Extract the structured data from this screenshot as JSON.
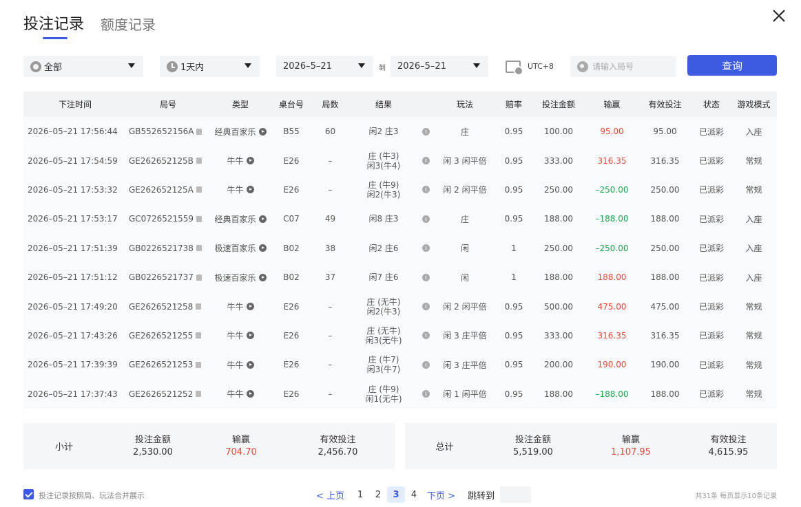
{
  "tabs": [
    {
      "label": "投注记录",
      "active": true
    },
    {
      "label": "额度记录",
      "active": false
    }
  ],
  "filters": {
    "game": "全部",
    "range": "1天内",
    "date_from": "2026–5–21",
    "to_label": "到",
    "date_to": "2026–5–21",
    "timezone": "UTC+8",
    "round_placeholder": "请输入局号",
    "query_label": "查询"
  },
  "table": {
    "headers": [
      "下注时间",
      "局号",
      "类型",
      "桌台号",
      "局数",
      "结果",
      "玩法",
      "赔率",
      "投注金额",
      "输赢",
      "有效投注",
      "状态",
      "游戏模式"
    ],
    "rows": [
      {
        "time": "2026–05–21 17:56:44",
        "id": "GB552652156A",
        "type": "经典百家乐",
        "table": "B55",
        "round": "60",
        "result": [
          "闲2 庄3"
        ],
        "play": "庄",
        "odds": "0.95",
        "bet": "100.00",
        "win": "95.00",
        "win_sign": "pos",
        "valid": "95.00",
        "status": "已派彩",
        "mode": "入座"
      },
      {
        "time": "2026–05–21 17:54:59",
        "id": "GE262652125B",
        "type": "牛牛",
        "table": "E26",
        "round": "–",
        "result": [
          "庄 (牛3)",
          "闲3(牛4)"
        ],
        "play": "闲 3 闲平倍",
        "odds": "0.95",
        "bet": "333.00",
        "win": "316.35",
        "win_sign": "pos",
        "valid": "316.35",
        "status": "已派彩",
        "mode": "常规"
      },
      {
        "time": "2026–05–21 17:53:32",
        "id": "GE262652125A",
        "type": "牛牛",
        "table": "E26",
        "round": "–",
        "result": [
          "庄 (牛9)",
          "闲2(牛3)"
        ],
        "play": "闲 2 闲平倍",
        "odds": "0.95",
        "bet": "250.00",
        "win": "–250.00",
        "win_sign": "neg",
        "valid": "250.00",
        "status": "已派彩",
        "mode": "常规"
      },
      {
        "time": "2026–05–21 17:53:17",
        "id": "GC0726521559",
        "type": "经典百家乐",
        "table": "C07",
        "round": "49",
        "result": [
          "闲8 庄3"
        ],
        "play": "庄",
        "odds": "0.95",
        "bet": "188.00",
        "win": "–188.00",
        "win_sign": "neg",
        "valid": "188.00",
        "status": "已派彩",
        "mode": "入座"
      },
      {
        "time": "2026–05–21 17:51:39",
        "id": "GB0226521738",
        "type": "极速百家乐",
        "table": "B02",
        "round": "38",
        "result": [
          "闲2 庄6"
        ],
        "play": "闲",
        "odds": "1",
        "bet": "250.00",
        "win": "–250.00",
        "win_sign": "neg",
        "valid": "250.00",
        "status": "已派彩",
        "mode": "入座"
      },
      {
        "time": "2026–05–21 17:51:12",
        "id": "GB0226521737",
        "type": "极速百家乐",
        "table": "B02",
        "round": "37",
        "result": [
          "闲7 庄6"
        ],
        "play": "闲",
        "odds": "1",
        "bet": "188.00",
        "win": "188.00",
        "win_sign": "pos",
        "valid": "188.00",
        "status": "已派彩",
        "mode": "入座"
      },
      {
        "time": "2026–05–21 17:49:20",
        "id": "GE2626521258",
        "type": "牛牛",
        "table": "E26",
        "round": "–",
        "result": [
          "庄 (无牛)",
          "闲2(牛3)"
        ],
        "play": "闲 2 闲平倍",
        "odds": "0.95",
        "bet": "500.00",
        "win": "475.00",
        "win_sign": "pos",
        "valid": "475.00",
        "status": "已派彩",
        "mode": "常规"
      },
      {
        "time": "2026–05–21 17:43:26",
        "id": "GE2626521255",
        "type": "牛牛",
        "table": "E26",
        "round": "–",
        "result": [
          "庄 (无牛)",
          "闲3(无牛)"
        ],
        "play": "闲 3 庄平倍",
        "odds": "0.95",
        "bet": "333.00",
        "win": "316.35",
        "win_sign": "pos",
        "valid": "316.35",
        "status": "已派彩",
        "mode": "常规"
      },
      {
        "time": "2026–05–21 17:39:39",
        "id": "GE2626521253",
        "type": "牛牛",
        "table": "E26",
        "round": "–",
        "result": [
          "庄 (牛7)",
          "闲3(牛7)"
        ],
        "play": "闲 3 庄平倍",
        "odds": "0.95",
        "bet": "200.00",
        "win": "190.00",
        "win_sign": "pos",
        "valid": "190.00",
        "status": "已派彩",
        "mode": "常规"
      },
      {
        "time": "2026–05–21 17:37:43",
        "id": "GE2626521252",
        "type": "牛牛",
        "table": "E26",
        "round": "–",
        "result": [
          "庄 (牛9)",
          "闲1(无牛)"
        ],
        "play": "闲 1 闲平倍",
        "odds": "0.95",
        "bet": "188.00",
        "win": "–188.00",
        "win_sign": "neg",
        "valid": "188.00",
        "status": "已派彩",
        "mode": "常规"
      }
    ]
  },
  "subtotal": {
    "label": "小计",
    "bet_label": "投注金额",
    "bet": "2,530.00",
    "win_label": "输赢",
    "win": "704.70",
    "valid_label": "有效投注",
    "valid": "2,456.70"
  },
  "total": {
    "label": "总计",
    "bet_label": "投注金额",
    "bet": "5,519.00",
    "win_label": "输赢",
    "win": "1,107.95",
    "valid_label": "有效投注",
    "valid": "4,615.95"
  },
  "footer": {
    "merge_label": "投注记录按照局、玩法合并展示",
    "prev": "< 上页",
    "pages": [
      "1",
      "2",
      "3",
      "4"
    ],
    "current_page": "3",
    "next": "下页 >",
    "jump_label": "跳转到",
    "summary": "共31条  每页显示10条记录"
  }
}
